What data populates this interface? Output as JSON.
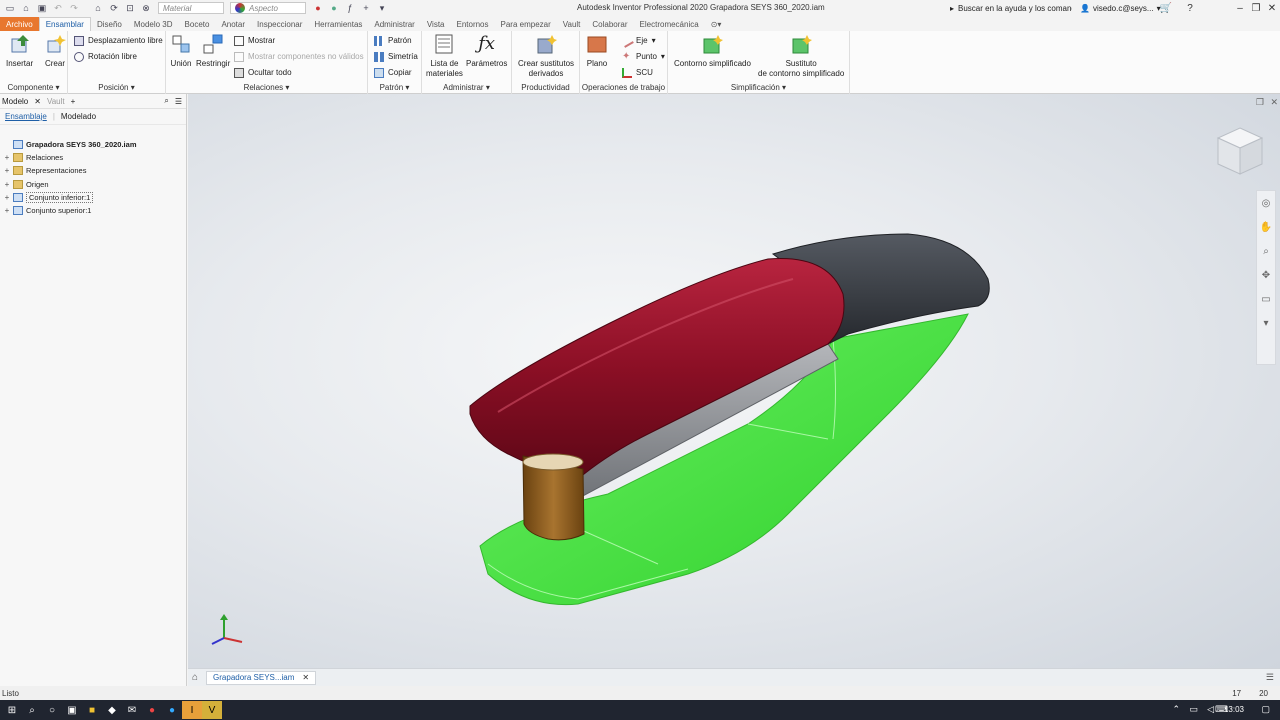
{
  "titlebar": {
    "app_title": "Autodesk Inventor Professional 2020    Grapadora SEYS 360_2020.iam",
    "material_placeholder": "Material",
    "appearance_placeholder": "Aspecto",
    "help_search": "Buscar en la ayuda y los comandos",
    "user": "visedo.c@seys..."
  },
  "ribbon_tabs": [
    "Archivo",
    "Ensamblar",
    "Diseño",
    "Modelo 3D",
    "Boceto",
    "Anotar",
    "Inspeccionar",
    "Herramientas",
    "Administrar",
    "Vista",
    "Entornos",
    "Para empezar",
    "Vault",
    "Colaborar",
    "Electromecánica"
  ],
  "ribbon": {
    "componente": {
      "label": "Componente",
      "insertar": "Insertar",
      "crear": "Crear"
    },
    "posicion": {
      "label": "Posición",
      "desplazamiento": "Desplazamiento libre",
      "rotacion": "Rotación libre"
    },
    "relaciones": {
      "label": "Relaciones",
      "union": "Unión",
      "restringir": "Restringir",
      "mostrar": "Mostrar",
      "mostrar_no_validos": "Mostrar componentes no válidos",
      "ocultar": "Ocultar todo"
    },
    "patron": {
      "label": "Patrón",
      "patron": "Patrón",
      "simetria": "Simetría",
      "copiar": "Copiar"
    },
    "administrar": {
      "label": "Administrar",
      "lista": "Lista de\nmateriales",
      "parametros": "Parámetros"
    },
    "productividad": {
      "label": "Productividad",
      "crear_sustitutos": "Crear sustitutos\nderivados"
    },
    "operaciones": {
      "label": "Operaciones de trabajo",
      "plano": "Plano",
      "eje": "Eje",
      "punto": "Punto",
      "scu": "SCU"
    },
    "simplificacion": {
      "label": "Simplificación",
      "contorno": "Contorno simplificado",
      "sustituto": "Sustituto\nde contorno simplificado"
    }
  },
  "browser": {
    "tab_model": "Modelo",
    "tab_vault": "Vault",
    "subtab_assembly": "Ensamblaje",
    "subtab_modeling": "Modelado",
    "tree": [
      {
        "label": "Grapadora SEYS 360_2020.iam",
        "level": 0,
        "kind": "root"
      },
      {
        "label": "Relaciones",
        "level": 1,
        "kind": "folder"
      },
      {
        "label": "Representaciones",
        "level": 1,
        "kind": "folder"
      },
      {
        "label": "Origen",
        "level": 1,
        "kind": "folder"
      },
      {
        "label": "Conjunto inferior:1",
        "level": 1,
        "kind": "subassembly"
      },
      {
        "label": "Conjunto superior:1",
        "level": 1,
        "kind": "subassembly"
      }
    ]
  },
  "viewport": {
    "colors": {
      "top_red": "#8b0f25",
      "rear_gray": "#3a3d44",
      "base_green": "#3fe33a",
      "pin_brown": "#8a5a1d",
      "metal": "#8d8f94"
    }
  },
  "doctab": {
    "label": "Grapadora SEYS...iam"
  },
  "statusbar": {
    "left": "Listo",
    "num_a": "17",
    "num_b": "20"
  },
  "taskbar": {
    "clock": "13:03"
  }
}
